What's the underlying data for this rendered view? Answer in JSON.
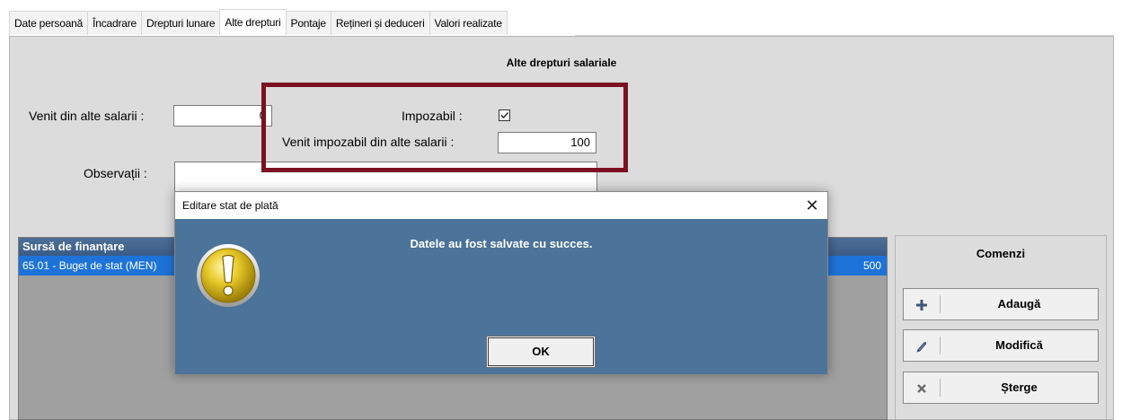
{
  "tabs": [
    {
      "label": "Date persoană"
    },
    {
      "label": "Încadrare"
    },
    {
      "label": "Drepturi lunare"
    },
    {
      "label": "Alte drepturi"
    },
    {
      "label": "Pontaje"
    },
    {
      "label": "Rețineri și deduceri"
    },
    {
      "label": "Valori realizate"
    }
  ],
  "active_tab": "Alte drepturi",
  "panel": {
    "title": "Alte drepturi salariale",
    "venit_alte_label": "Venit din alte salarii :",
    "venit_alte_value": "0",
    "impozabil_label": "Impozabil :",
    "impozabil_checked": true,
    "venit_impozabil_label": "Venit impozabil din alte salarii :",
    "venit_impozabil_value": "100",
    "observatii_label": "Observații :",
    "observatii_value": ""
  },
  "grid": {
    "header": "Sursă de finanțare",
    "rows": [
      {
        "source": "65.01 - Buget de stat (MEN)",
        "amount": "500"
      }
    ]
  },
  "commands": {
    "title": "Comenzi",
    "buttons": [
      {
        "label": "Adaugă",
        "icon": "plus-icon"
      },
      {
        "label": "Modifică",
        "icon": "pencil-icon"
      },
      {
        "label": "Șterge",
        "icon": "x-icon"
      }
    ]
  },
  "dialog": {
    "title": "Editare stat de plată",
    "message": "Datele au fost salvate cu succes.",
    "ok_label": "OK",
    "close_glyph": "✕",
    "icon": "exclamation-icon"
  },
  "colors": {
    "highlight_border": "#7b1122",
    "dialog_body": "#4c7399",
    "grid_selected_row": "#1e73d8",
    "grid_header": "#3b5c86"
  }
}
